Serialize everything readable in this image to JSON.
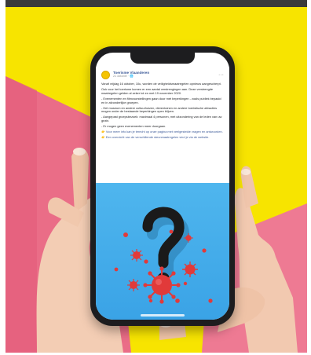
{
  "post": {
    "page_name": "Toerisme Vlaanderen",
    "meta": "21 oktober · 🌐",
    "more": "···",
    "paragraphs": [
      "Vanaf vrijdag 16 oktober, 10u, worden de veiligheidsmaatregelen opnieuw aangescherpt.",
      "Ook voor het toerisme komen er een aantal verstrengingen aan. Deze verstrengde maatregelen gelden al zeker tot en met 19 november 2020.",
      "- Evenementen en filmvoorstellingen gaan door met beperkingen - zoals publiek bepaald en in afzonderlijke groepen.",
      "- Het museum en andere cultuurhuizen, dierentuinen en andere toeristische attracties mogen onder de bestaande beperkingen open blijven.",
      "- Aangepast groepsbezoek: maximaal 4 personen, met uitzondering van de leden van uw gezin.",
      "- Er mogen geen evenementen meer doorgaan.",
      "👉 Voor meer info kan je terecht op onze pagina met veelgestelde vragen en antwoorden.",
      "👉 Een overzicht van de verschillende steunmaatregelen vind je via de website."
    ]
  },
  "colors": {
    "yellow": "#f7e400",
    "pink": "#ea6d87",
    "sky": "#43aeea",
    "virus": "#e13a3a",
    "phone": "#1d1d1f"
  }
}
